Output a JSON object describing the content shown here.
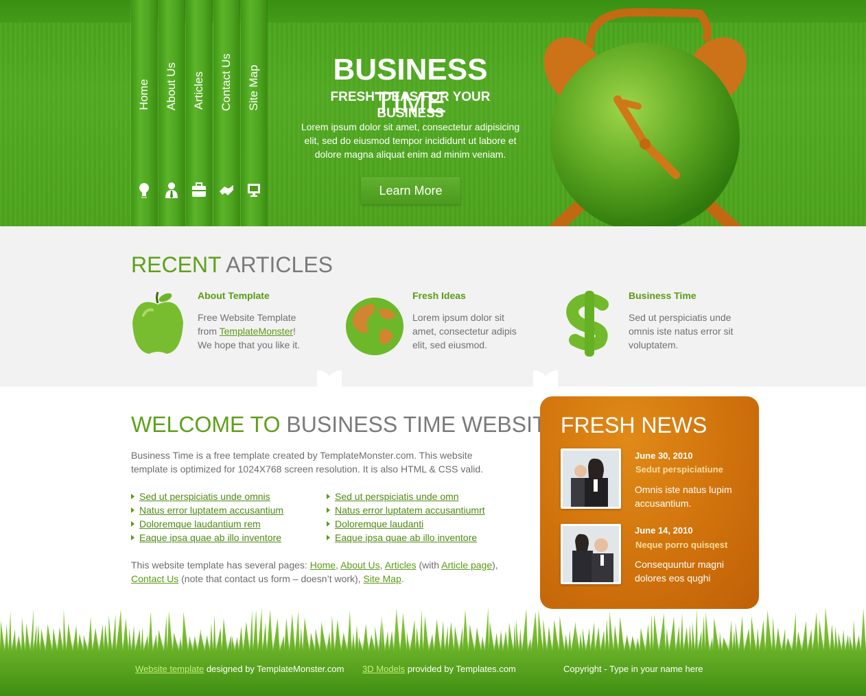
{
  "nav": [
    {
      "label": "Home",
      "icon": "lightbulb-icon"
    },
    {
      "label": "About Us",
      "icon": "person-icon"
    },
    {
      "label": "Articles",
      "icon": "briefcase-icon"
    },
    {
      "label": "Contact Us",
      "icon": "handshake-icon"
    },
    {
      "label": "Site Map",
      "icon": "monitor-icon"
    }
  ],
  "hero": {
    "title_bold": "BUSINESS",
    "title_light": "TIME",
    "subtitle": "FRESH IDEAS FOR YOUR BUSINESS",
    "text": "Lorem ipsum dolor sit amet, consectetur adipisicing elit, sed do eiusmod tempor incididunt ut labore et dolore magna aliquat enim ad minim veniam.",
    "button": "Learn More"
  },
  "articles": {
    "heading_green": "RECENT",
    "heading_grey": "ARTICLES",
    "items": [
      {
        "title": "About Template",
        "text_pre": "Free Website Template from ",
        "link": "TemplateMonster",
        "text_post": "! We hope that you like it.",
        "icon": "apple-icon"
      },
      {
        "title": "Fresh Ideas",
        "text": "Lorem ipsum dolor sit amet, consectetur adipis elit, sed eiusmod.",
        "icon": "globe-icon"
      },
      {
        "title": "Business Time",
        "text": "Sed ut perspiciatis unde omnis iste natus error sit voluptatem.",
        "icon": "dollar-icon"
      }
    ]
  },
  "welcome": {
    "heading_green": "WELCOME TO",
    "heading_grey": "BUSINESS TIME WEBSITE!",
    "paragraph": "Business Time is a free template created by TemplateMonster.com. This website template is optimized for 1024X768 screen resolution. It is also HTML & CSS valid.",
    "list_left": [
      "Sed ut perspiciatis unde omnis",
      "Natus error luptatem accusantium",
      "Doloremque laudantium rem",
      "Eaque ipsa quae ab illo inventore"
    ],
    "list_right": [
      "Sed ut perspiciatis unde omn",
      "Natus error luptatem accusantiumrt",
      "Doloremque laudanti",
      "Eaque ipsa quae ab illo inventore"
    ],
    "pages_text_1": "This website template has several pages: ",
    "pages_home": "Home",
    "pages_about": "About Us",
    "pages_articles": "Articles",
    "pages_with": " (with ",
    "pages_article_page": "Article page",
    "pages_close": "),",
    "pages_contact": "Contact Us",
    "pages_note": " (note that contact us form – doesn’t work), ",
    "pages_sitemap": "Site Map",
    "pages_end": "."
  },
  "news": {
    "heading": "FRESH NEWS",
    "items": [
      {
        "date": "June 30, 2010",
        "title": "Sedut perspiciatiune",
        "text": "Omnis iste natus lupim accusantium."
      },
      {
        "date": "June 14, 2010",
        "title": "Neque porro quisqest",
        "text": "Consequuntur magni dolores eos qughi"
      }
    ]
  },
  "footer": {
    "link1": "Website template",
    "text1": " designed by TemplateMonster.com",
    "link2": "3D Models",
    "text2": " provided by Templates.com",
    "copyright": "Copyright - Type in your name here"
  },
  "colors": {
    "green": "#5ea019",
    "orange": "#d0720c",
    "grey_heading": "#7a7a7a"
  }
}
